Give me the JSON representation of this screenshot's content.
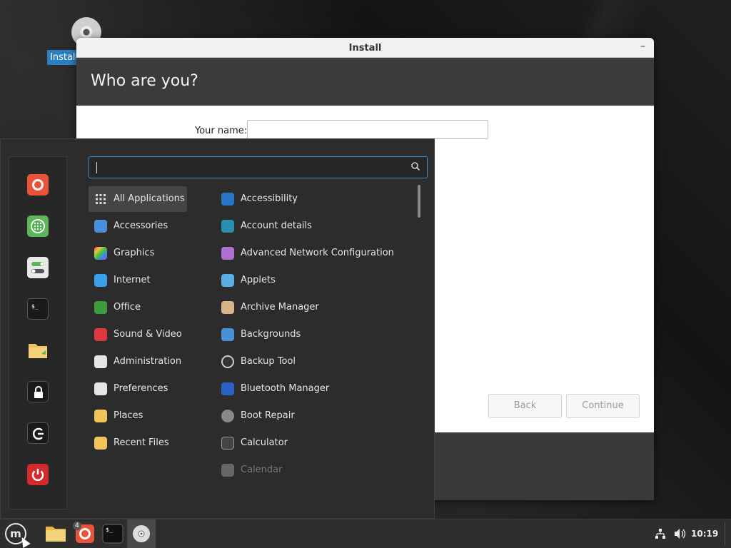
{
  "desktop": {
    "icon_label": "Install"
  },
  "window": {
    "title": "Install",
    "minimize": "–",
    "heading": "Who are you?",
    "name_label": "Your name:",
    "name_value": "",
    "back_label": "Back",
    "continue_label": "Continue"
  },
  "menu": {
    "search": {
      "value": "",
      "placeholder": ""
    },
    "favorites": [
      {
        "name": "firefox",
        "color": "#e8533a"
      },
      {
        "name": "software-manager",
        "color": "#5db65a"
      },
      {
        "name": "settings",
        "color": "#e9e9e9"
      },
      {
        "name": "terminal",
        "color": "#1a1a1a"
      },
      {
        "name": "files",
        "color": "#f0c45a"
      },
      {
        "name": "lock-screen",
        "color": "#1a1a1a"
      },
      {
        "name": "logout",
        "color": "#1a1a1a"
      },
      {
        "name": "shutdown",
        "color": "#d32b2b"
      }
    ],
    "categories": [
      {
        "label": "All Applications",
        "icon": "grid-icon",
        "color": "#dddddd"
      },
      {
        "label": "Accessories",
        "icon": "scissors-icon",
        "color": "#4a90d9"
      },
      {
        "label": "Graphics",
        "icon": "palette-icon",
        "color": "#c040c0"
      },
      {
        "label": "Internet",
        "icon": "cloud-icon",
        "color": "#3aa0e8"
      },
      {
        "label": "Office",
        "icon": "office-icon",
        "color": "#3d9a3d"
      },
      {
        "label": "Sound & Video",
        "icon": "play-icon",
        "color": "#e0383f"
      },
      {
        "label": "Administration",
        "icon": "toggle-icon",
        "color": "#e5e5e5"
      },
      {
        "label": "Preferences",
        "icon": "switches-icon",
        "color": "#e5e5e5"
      },
      {
        "label": "Places",
        "icon": "folder-icon",
        "color": "#f0c45a"
      },
      {
        "label": "Recent Files",
        "icon": "recent-folder-icon",
        "color": "#f0c45a"
      }
    ],
    "apps": [
      {
        "label": "Accessibility",
        "icon": "accessibility-icon",
        "color": "#2a75c9"
      },
      {
        "label": "Account details",
        "icon": "user-icon",
        "color": "#2b8fb0"
      },
      {
        "label": "Advanced Network Configuration",
        "icon": "network-arrows-icon",
        "color": "#b070d0"
      },
      {
        "label": "Applets",
        "icon": "applets-icon",
        "color": "#5aaee8"
      },
      {
        "label": "Archive Manager",
        "icon": "archive-icon",
        "color": "#d9b48a"
      },
      {
        "label": "Backgrounds",
        "icon": "backgrounds-icon",
        "color": "#4a90d9"
      },
      {
        "label": "Backup Tool",
        "icon": "backup-icon",
        "color": "#333333"
      },
      {
        "label": "Bluetooth Manager",
        "icon": "bluetooth-icon",
        "color": "#2a62c9"
      },
      {
        "label": "Boot Repair",
        "icon": "boot-repair-icon",
        "color": "#888888"
      },
      {
        "label": "Calculator",
        "icon": "calculator-icon",
        "color": "#444444"
      },
      {
        "label": "Calendar",
        "icon": "calendar-icon",
        "color": "#666666"
      }
    ]
  },
  "taskbar": {
    "firefox_badge": "4",
    "clock": "10:19"
  }
}
